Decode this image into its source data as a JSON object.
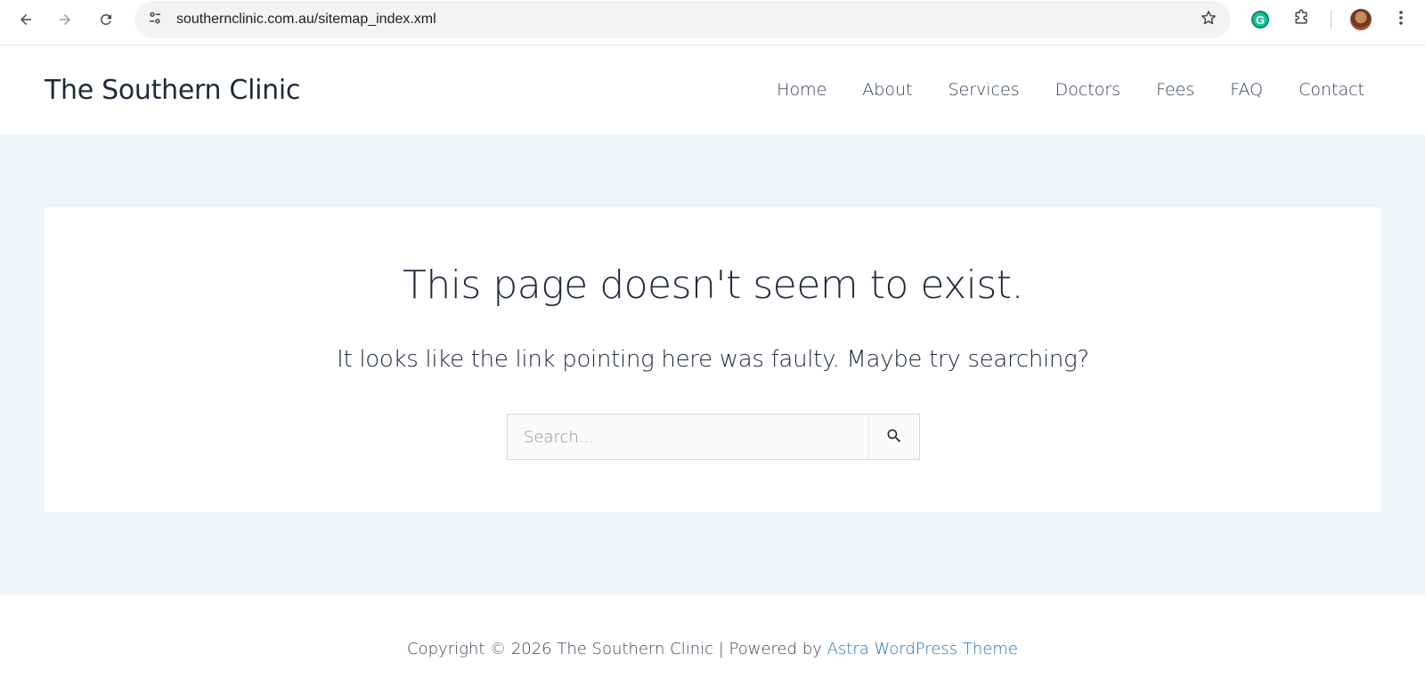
{
  "browser": {
    "url": "southernclinic.com.au/sitemap_index.xml",
    "icons": {
      "back": "arrow-left-icon",
      "forward": "arrow-right-icon",
      "reload": "reload-icon",
      "site_info": "tune-icon",
      "bookmark": "star-icon",
      "grammarly": "grammarly-icon",
      "extensions": "puzzle-icon",
      "profile": "avatar",
      "menu": "kebab-menu-icon"
    },
    "grammarly_letter": "G"
  },
  "header": {
    "site_title": "The Southern Clinic",
    "nav": [
      {
        "label": "Home"
      },
      {
        "label": "About"
      },
      {
        "label": "Services"
      },
      {
        "label": "Doctors"
      },
      {
        "label": "Fees"
      },
      {
        "label": "FAQ"
      },
      {
        "label": "Contact"
      }
    ]
  },
  "main": {
    "heading": "This page doesn't seem to exist.",
    "subheading": "It looks like the link pointing here was faulty. Maybe try searching?",
    "search": {
      "placeholder": "Search...",
      "value": "",
      "button_icon": "search-icon"
    }
  },
  "footer": {
    "text": "Copyright © 2026 The Southern Clinic | Powered by ",
    "link_label": "Astra WordPress Theme"
  },
  "colors": {
    "accent_link": "#2271b1",
    "page_background": "#f0f5fa",
    "text": "#1e293b"
  }
}
